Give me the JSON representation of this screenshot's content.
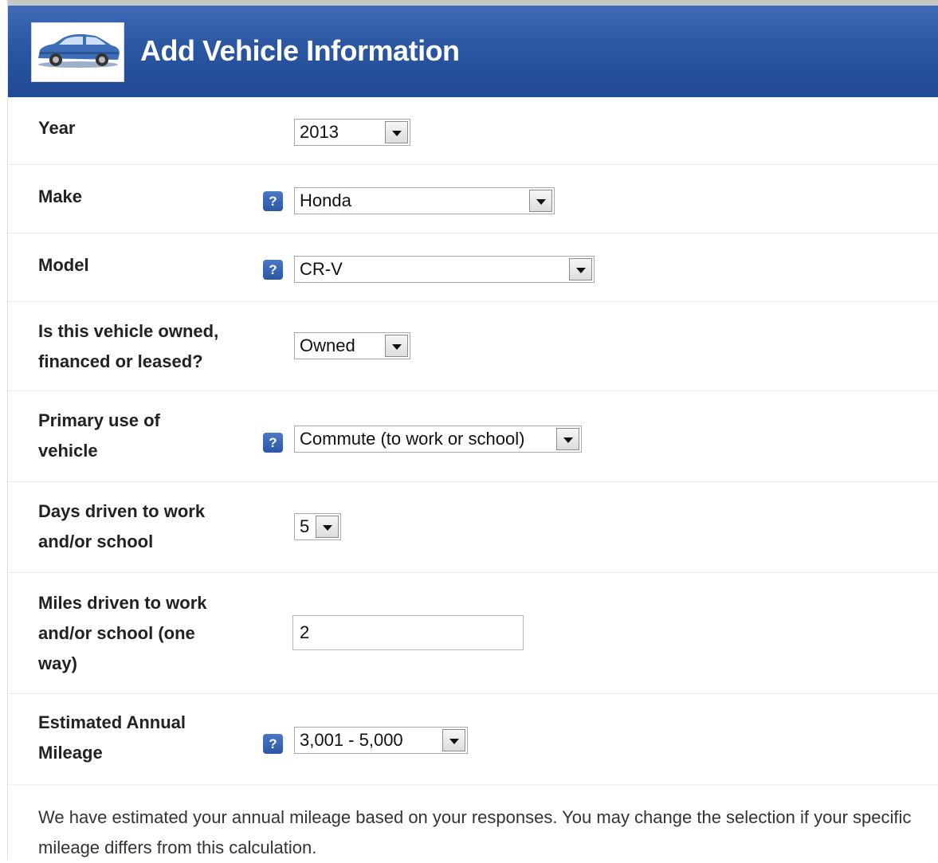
{
  "header": {
    "title": "Add Vehicle Information",
    "icon": "car-icon"
  },
  "fields": {
    "year": {
      "label": "Year",
      "value": "2013"
    },
    "make": {
      "label": "Make",
      "value": "Honda"
    },
    "model": {
      "label": "Model",
      "value": "CR-V"
    },
    "ownership": {
      "label": "Is this vehicle owned,\nfinanced or leased?",
      "value": "Owned"
    },
    "primary_use": {
      "label": "Primary use of\nvehicle",
      "value": "Commute (to work or school)"
    },
    "days_driven": {
      "label": "Days driven to work\nand/or school",
      "value": "5"
    },
    "miles_driven": {
      "label": "Miles driven to work\nand/or school (one\nway)",
      "value": "2"
    },
    "annual_mileage": {
      "label": "Estimated Annual\nMileage",
      "value": "3,001 - 5,000"
    }
  },
  "help_icon_glyph": "?",
  "note": "We have estimated your annual mileage based on your responses. You may change the selection if your specific mileage differs from this calculation.",
  "colors": {
    "header_blue": "#2a56a2",
    "help_blue": "#3a68b6"
  }
}
